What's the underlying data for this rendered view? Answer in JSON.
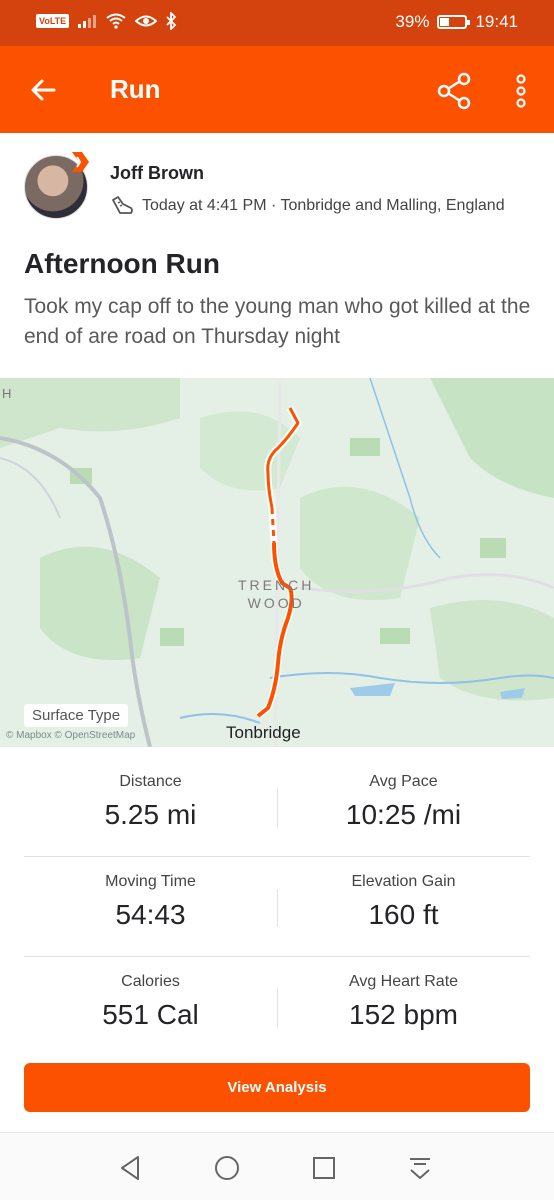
{
  "status_bar": {
    "volte": "VoLTE",
    "battery": "39%",
    "battery_level": 0.39,
    "time": "19:41"
  },
  "app_bar": {
    "title": "Run",
    "back_icon": "arrow-left-icon",
    "share_icon": "share-icon",
    "more_icon": "more-vertical-icon"
  },
  "athlete": {
    "name": "Joff Brown",
    "timestamp": "Today at 4:41 PM · Tonbridge and Malling, England",
    "activity_icon": "running-shoe-icon"
  },
  "activity": {
    "title": "Afternoon Run",
    "description": "Took my cap off to the young man who got killed at the end of are road on Thursday night"
  },
  "map": {
    "edge_label": "H",
    "wood_line1": "TRENCH",
    "wood_line2": "WOOD",
    "town": "Tonbridge",
    "surface_type": "Surface Type",
    "attribution": "© Mapbox © OpenStreetMap"
  },
  "stats": [
    {
      "label": "Distance",
      "value": "5.25 mi"
    },
    {
      "label": "Avg Pace",
      "value": "10:25 /mi"
    },
    {
      "label": "Moving Time",
      "value": "54:43"
    },
    {
      "label": "Elevation Gain",
      "value": "160 ft"
    },
    {
      "label": "Calories",
      "value": "551 Cal"
    },
    {
      "label": "Avg Heart Rate",
      "value": "152 bpm"
    }
  ],
  "cta": {
    "label": "View Analysis"
  },
  "colors": {
    "brand": "#fc5200",
    "status_bar": "#d4430d",
    "route": "#fc5200"
  },
  "nav": {
    "back": "nav-back-icon",
    "home": "nav-home-icon",
    "recents": "nav-recents-icon",
    "notifications": "nav-pull-down-icon"
  }
}
